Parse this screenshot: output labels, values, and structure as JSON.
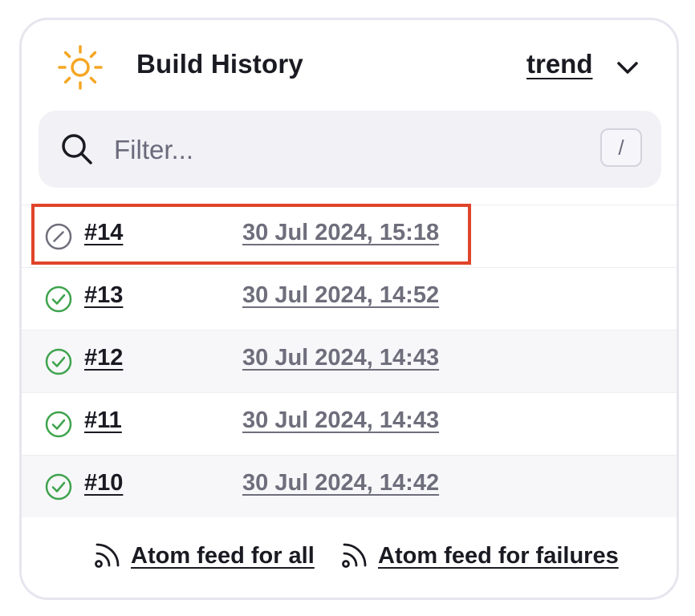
{
  "header": {
    "title": "Build History",
    "trend_label": "trend",
    "sun_icon": "sun-icon",
    "chevron_icon": "chevron-down-icon"
  },
  "filter": {
    "placeholder": "Filter...",
    "value": "",
    "shortcut": "/",
    "icon": "search-icon"
  },
  "builds": [
    {
      "number": "#14",
      "date": "30 Jul 2024, 15:18",
      "status": "aborted",
      "selected": true
    },
    {
      "number": "#13",
      "date": "30 Jul 2024, 14:52",
      "status": "success"
    },
    {
      "number": "#12",
      "date": "30 Jul 2024, 14:43",
      "status": "success"
    },
    {
      "number": "#11",
      "date": "30 Jul 2024, 14:43",
      "status": "success"
    },
    {
      "number": "#10",
      "date": "30 Jul 2024, 14:42",
      "status": "success"
    }
  ],
  "footer": {
    "feed_all": "Atom feed for all",
    "feed_failures": "Atom feed for failures",
    "icon": "rss-icon"
  },
  "colors": {
    "accent_sun": "#f5a623",
    "success": "#3fa34d",
    "aborted": "#6e6e7c",
    "highlight": "#e0442a"
  }
}
